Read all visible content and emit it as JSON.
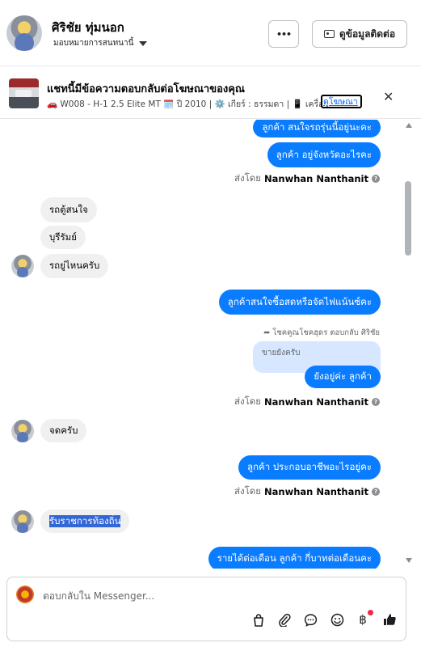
{
  "header": {
    "name": "ศิริชัย ทุ่มนอก",
    "assign_label": "มอบหมายการสนทนานี้",
    "contact_button": "ดูข้อมูลติดต่อ",
    "more_button": "•••"
  },
  "ad": {
    "title": "แชทนี้มีข้อความตอบกลับต่อโฆษณาของคุณ",
    "details": "🚗 W008 - H-1 2.5 Elite MT 🗓️ ปี 2010 | ⚙️ เกียร์ : ธรรมดา | 📱 เครื่อง...",
    "link": "ดูโฆษณา",
    "close": "✕"
  },
  "messages": {
    "m1": "ลูกค้า สนใจรถรุ่นนี้อยู่นะคะ",
    "m2": "ลูกค้า อยู่จังหวัดอะไรคะ",
    "sent_prefix": "ส่งโดย",
    "sender": "Nanwhan Nanthanit",
    "m3": "รถตู้สนใจ",
    "m4": "บุรีรัมย์",
    "m5": "รถยู่ไหนครับ",
    "m6": "ลูกค้าสนใจซื้อสดหรือจัดไฟแน้นซ์คะ",
    "reply_note": "โชคคูณโชคฮุดร ตอบกลับ ศิริชัย",
    "quote": "ขายยังครับ",
    "m7": "ยังอยู่ค่ะ ลูกค้า",
    "m8": "จดครับ",
    "m9": "ลูกค้า ประกอบอาชีพอะไรอยู่คะ",
    "m10": "รับราชการท้องถิ่น",
    "m11": "รายได้ต่อเดือน ลูกค้า กี่บาทต่อเดือนคะ"
  },
  "composer": {
    "placeholder": "ตอบกลับใน Messenger..."
  },
  "colors": {
    "outgoing_bubble": "#0a7cff",
    "incoming_bubble": "#f0f0f0",
    "quote_bubble": "#d7e7ff",
    "notification_dot": "#f02849"
  },
  "icons": [
    "bag-icon",
    "paperclip-icon",
    "chat-bubble-icon",
    "emoji-icon",
    "baht-icon",
    "thumbs-up-icon",
    "id-card-icon",
    "close-icon",
    "info-icon",
    "reply-arrow-icon"
  ]
}
